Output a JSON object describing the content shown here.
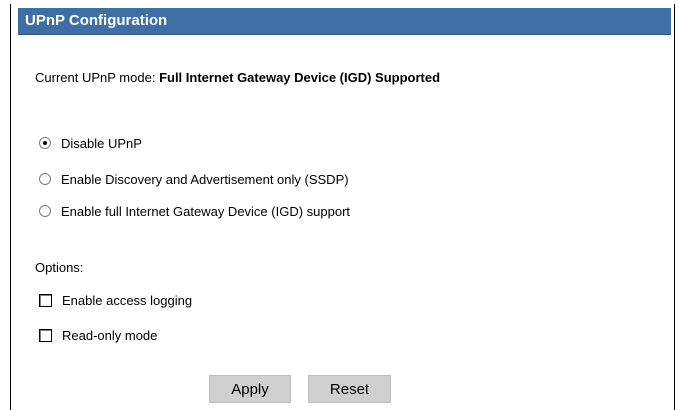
{
  "header": {
    "title": "UPnP Configuration"
  },
  "mode": {
    "label": "Current UPnP mode:",
    "value": "Full Internet Gateway Device (IGD) Supported"
  },
  "upnp_options": [
    {
      "label": "Disable UPnP",
      "selected": true
    },
    {
      "label": "Enable Discovery and Advertisement only (SSDP)",
      "selected": false
    },
    {
      "label": "Enable full Internet Gateway Device (IGD) support",
      "selected": false
    }
  ],
  "options": {
    "label": "Options:",
    "items": [
      {
        "label": "Enable access logging",
        "checked": false
      },
      {
        "label": "Read-only mode",
        "checked": false
      }
    ]
  },
  "buttons": {
    "apply": "Apply",
    "reset": "Reset"
  },
  "colors": {
    "header_background": "#3d6ea6",
    "header_text": "#ffffff",
    "button_background": "#cfcfcf"
  }
}
